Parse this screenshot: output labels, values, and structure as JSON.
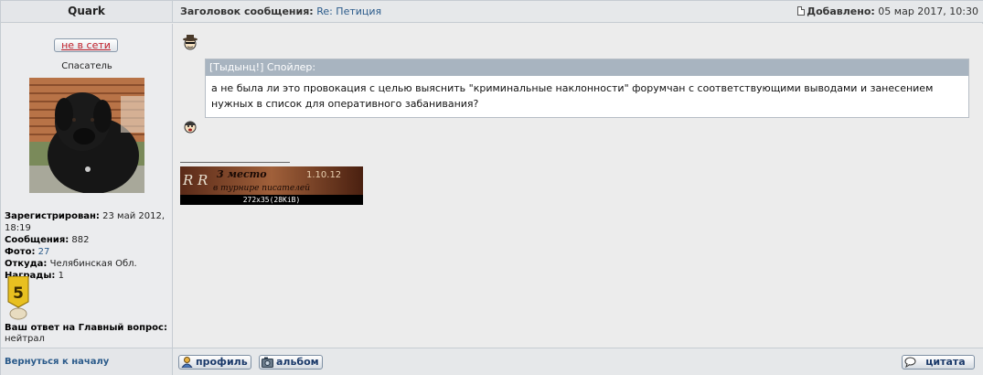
{
  "header": {
    "author": "Quark",
    "subject_label": "Заголовок сообщения:",
    "subject_value": "Re: Петиция",
    "added_label": "Добавлено:",
    "added_value": "05 мар 2017, 10:30"
  },
  "profile": {
    "status_button": "не в сети",
    "rank": "Спасатель",
    "registered_label": "Зарегистрирован:",
    "registered_value": "23 май 2012, 18:19",
    "posts_label": "Сообщения:",
    "posts_value": "882",
    "photos_label": "Фото:",
    "photos_value": "27",
    "from_label": "Откуда:",
    "from_value": "Челябинская Обл.",
    "awards_label": "Награды:",
    "awards_value": "1",
    "medal_number": "5",
    "answer_label": "Ваш ответ на Главный вопрос:",
    "answer_value": "нейтрал"
  },
  "message": {
    "spoiler_toggle": "[Тыдынц!]",
    "spoiler_title": "Спойлер:",
    "spoiler_text": "а не была ли это провокация с целью выяснить \"криминальные наклонности\" форумчан с соответствующими выводами и занесением нужных в список для оперативного забанивания?",
    "signature_caption": "272x35(28KiB)",
    "signature_text_1": "3 место",
    "signature_text_2": "в турнире писателей",
    "signature_date": "1.10.12",
    "signature_mark": "R R"
  },
  "footer": {
    "back_link": "Вернуться к началу",
    "profile_button": "профиль",
    "album_button": "альбом",
    "quote_button": "цитата"
  },
  "colors": {
    "link": "#2a5a8a",
    "offline": "#c0202a",
    "spoiler_header": "#a8b4c0"
  }
}
